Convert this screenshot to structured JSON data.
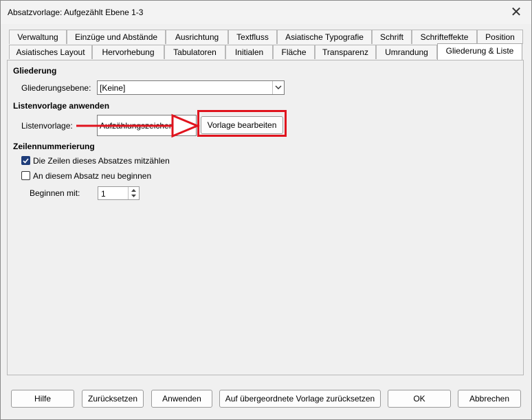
{
  "window": {
    "title": "Absatzvorlage: Aufgezählt Ebene 1-3"
  },
  "tabs_row1": [
    "Verwaltung",
    "Einzüge und Abstände",
    "Ausrichtung",
    "Textfluss",
    "Asiatische Typografie",
    "Schrift",
    "Schrifteffekte",
    "Position"
  ],
  "tabs_row2": [
    "Asiatisches Layout",
    "Hervorhebung",
    "Tabulatoren",
    "Initialen",
    "Fläche",
    "Transparenz",
    "Umrandung",
    "Gliederung & Liste"
  ],
  "active_tab": "Gliederung & Liste",
  "outline": {
    "header": "Gliederung",
    "level_label": "Gliederungsebene:",
    "level_value": "[Keine]"
  },
  "list_style": {
    "header": "Listenvorlage anwenden",
    "label": "Listenvorlage:",
    "value": "Aufzählungszeichen",
    "edit_button": "Vorlage bearbeiten"
  },
  "line_numbering": {
    "header": "Zeilennummerierung",
    "count_lines_label": "Die Zeilen dieses Absatzes mitzählen",
    "count_lines_checked": true,
    "restart_label": "An diesem Absatz neu beginnen",
    "restart_checked": false,
    "start_label": "Beginnen mit:",
    "start_value": "1"
  },
  "buttons": {
    "help": "Hilfe",
    "reset": "Zurücksetzen",
    "apply": "Anwenden",
    "reset_parent": "Auf übergeordnete Vorlage zurücksetzen",
    "ok": "OK",
    "cancel": "Abbrechen"
  },
  "colors": {
    "annotation_red": "#e0141e",
    "checkbox_blue": "#1f3d7a"
  }
}
